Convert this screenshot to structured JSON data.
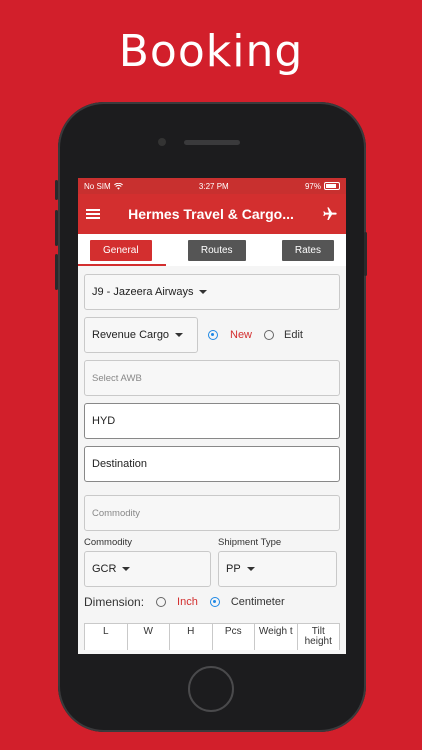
{
  "headline": "Booking",
  "status_bar": {
    "carrier": "No SIM",
    "time": "3:27 PM",
    "battery": "97%"
  },
  "app_bar": {
    "title": "Hermes Travel & Cargo..."
  },
  "tabs": [
    {
      "label": "General",
      "active": true
    },
    {
      "label": "Routes",
      "active": false
    },
    {
      "label": "Rates",
      "active": false
    }
  ],
  "form": {
    "airline": "J9 - Jazeera Airways",
    "cargo_type": "Revenue Cargo",
    "mode": {
      "new_label": "New",
      "edit_label": "Edit",
      "selected": "New"
    },
    "select_awb_placeholder": "Select AWB",
    "origin": "HYD",
    "destination_placeholder": "Destination",
    "commodity_placeholder": "Commodity",
    "commodity_label": "Commodity",
    "commodity_value": "GCR",
    "shipment_type_label": "Shipment Type",
    "shipment_type_value": "PP",
    "dimension": {
      "label": "Dimension:",
      "inch_label": "Inch",
      "cm_label": "Centimeter",
      "selected": "Centimeter"
    },
    "dimension_columns": [
      "L",
      "W",
      "H",
      "Pcs",
      "Weigh t",
      "Tilt height"
    ]
  },
  "colors": {
    "brand_red": "#d21f2b",
    "appbar_red": "#d32f2f",
    "radio_blue": "#1e88e5"
  }
}
